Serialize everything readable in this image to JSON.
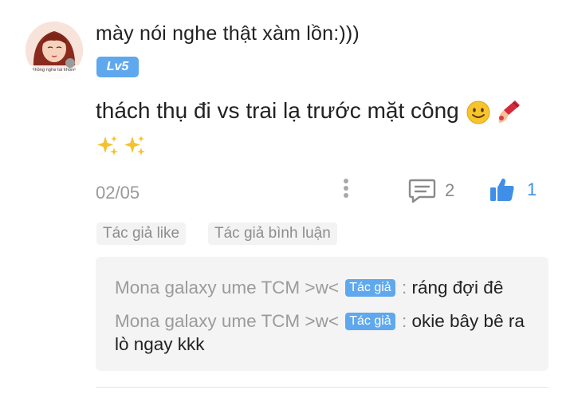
{
  "comment": {
    "username": "mày nói nghe thật xàm lồn:)))",
    "level": "Lv5",
    "avatar_caption": "không nghe tai không",
    "content_text": "thách thụ đi vs trai lạ trước mặt công",
    "content_emojis": [
      "slightly-smiling-face",
      "nail-polish",
      "sparkles",
      "sparkles"
    ],
    "date": "02/05",
    "reply_count": "2",
    "like_count": "1",
    "tags": [
      "Tác giả like",
      "Tác giả bình luận"
    ],
    "replies": [
      {
        "author": "Mona galaxy ume TCM >w<",
        "badge": "Tác giả",
        "separator": ":",
        "text": "ráng đợi đê"
      },
      {
        "author": "Mona galaxy ume TCM >w<",
        "badge": "Tác giả",
        "separator": ":",
        "text": "okie bây bê ra lò ngay kkk"
      }
    ]
  },
  "colors": {
    "accent_blue": "#5fa8ee",
    "like_blue": "#3f8fe8",
    "muted_text": "#9a9a9a",
    "reply_box_bg": "#f4f4f4"
  },
  "icons": {
    "more": "more-vertical-icon",
    "reply": "comment-bubble-icon",
    "like": "thumbs-up-icon"
  }
}
